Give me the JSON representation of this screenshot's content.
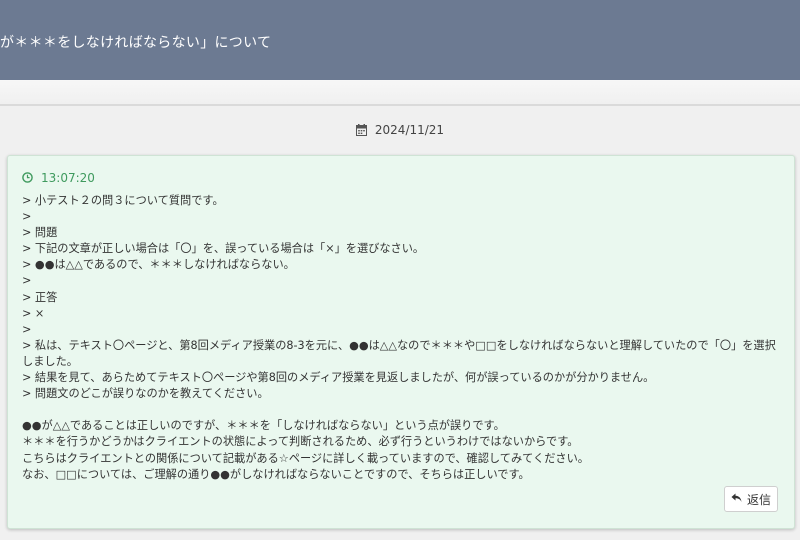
{
  "header": {
    "title": "が＊＊＊をしなければならない」について"
  },
  "date": {
    "text": "2024/11/21",
    "icon": "calendar-icon"
  },
  "post": {
    "time": "13:07:20",
    "time_icon": "clock-icon",
    "accent_color": "#3f9a5e",
    "background_color": "#eaf8ef",
    "lines": [
      "> 小テスト２の問３について質問です。",
      ">",
      "> 問題",
      "> 下記の文章が正しい場合は「〇」を、誤っている場合は「×」を選びなさい。",
      "> ●●は△△であるので、＊＊＊しなければならない。",
      ">",
      "> 正答",
      "> ×",
      ">",
      "> 私は、テキスト〇ページと、第8回メディア授業の8-3を元に、●●は△△なので＊＊＊や□□をしなければならないと理解していたので「〇」を選択しました。",
      "> 結果を見て、あらためてテキスト〇ページや第8回のメディア授業を見返しましたが、何が誤っているのかが分かりません。",
      "> 問題文のどこが誤りなのかを教えてください。",
      "",
      "●●が△△であることは正しいのですが、＊＊＊を「しなければならない」という点が誤りです。",
      "＊＊＊を行うかどうかはクライエントの状態によって判断されるため、必ず行うというわけではないからです。",
      "こちらはクライエントとの関係について記載がある☆ページに詳しく載っていますので、確認してみてください。",
      "なお、□□については、ご理解の通り●●がしなければならないことですので、そちらは正しいです。"
    ],
    "reply_label": "返信",
    "reply_icon": "reply-arrow-icon"
  }
}
